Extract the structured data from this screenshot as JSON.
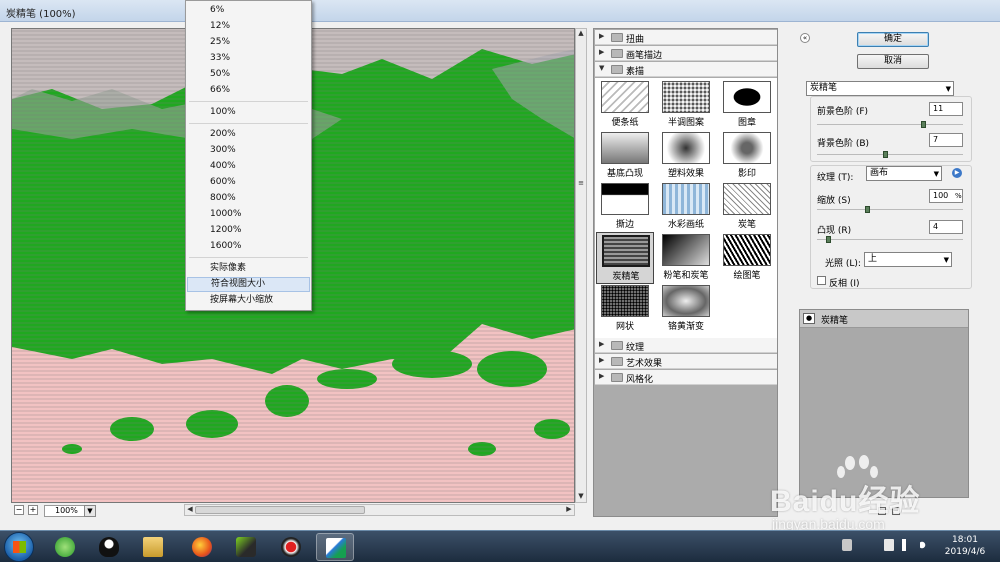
{
  "window": {
    "title": "炭精笔 (100%)"
  },
  "preview": {
    "zoom_value": "100%",
    "zoom_minus": "−",
    "zoom_plus": "+"
  },
  "zoom_menu": {
    "items": [
      "6%",
      "12%",
      "25%",
      "33%",
      "50%",
      "66%",
      "100%",
      "200%",
      "300%",
      "400%",
      "600%",
      "800%",
      "1000%",
      "1200%",
      "1600%",
      "实际像素",
      "符合视图大小",
      "按屏幕大小缩放"
    ],
    "highlighted": "符合视图大小"
  },
  "filter_gallery": {
    "categories_top": [
      "扭曲",
      "画笔描边",
      "素描"
    ],
    "categories_bottom": [
      "纹理",
      "艺术效果",
      "风格化"
    ],
    "sketch_filters": [
      "便条纸",
      "半调图案",
      "图章",
      "基底凸现",
      "塑料效果",
      "影印",
      "撕边",
      "水彩画纸",
      "炭笔",
      "炭精笔",
      "粉笔和炭笔",
      "绘图笔",
      "网状",
      "铬黄渐变"
    ],
    "selected": "炭精笔"
  },
  "buttons": {
    "ok": "确定",
    "cancel": "取消"
  },
  "params": {
    "filter_select": "炭精笔",
    "foreground_label": "前景色阶 (F)",
    "foreground_value": "11",
    "foreground_level": 0.73,
    "background_label": "背景色阶 (B)",
    "background_value": "7",
    "background_level": 0.47,
    "texture_label": "纹理 (T):",
    "texture_value": "画布",
    "scaling_label": "缩放 (S)",
    "scaling_value": "100",
    "scaling_unit": "%",
    "scaling_level": 0.35,
    "relief_label": "凸现 (R)",
    "relief_value": "4",
    "relief_level": 0.08,
    "light_label": "光照 (L):",
    "light_value": "上",
    "invert_label": "反相 (I)"
  },
  "layers": {
    "active_layer": "炭精笔"
  },
  "taskbar": {
    "time": "18:01",
    "date": "2019/4/6",
    "apps": [
      "ie-browser-icon",
      "folder-icon",
      "qq-icon",
      "firefox-icon",
      "video-icon",
      "record-icon",
      "photoshop-feather-icon"
    ]
  },
  "watermark": {
    "brand": "Baidu经验",
    "url": "jingyan.baidu.com"
  },
  "colors": {
    "preview_green": "#1ea81e",
    "preview_pink": "#f2c2c2",
    "highlight": "#dbe7f6"
  }
}
